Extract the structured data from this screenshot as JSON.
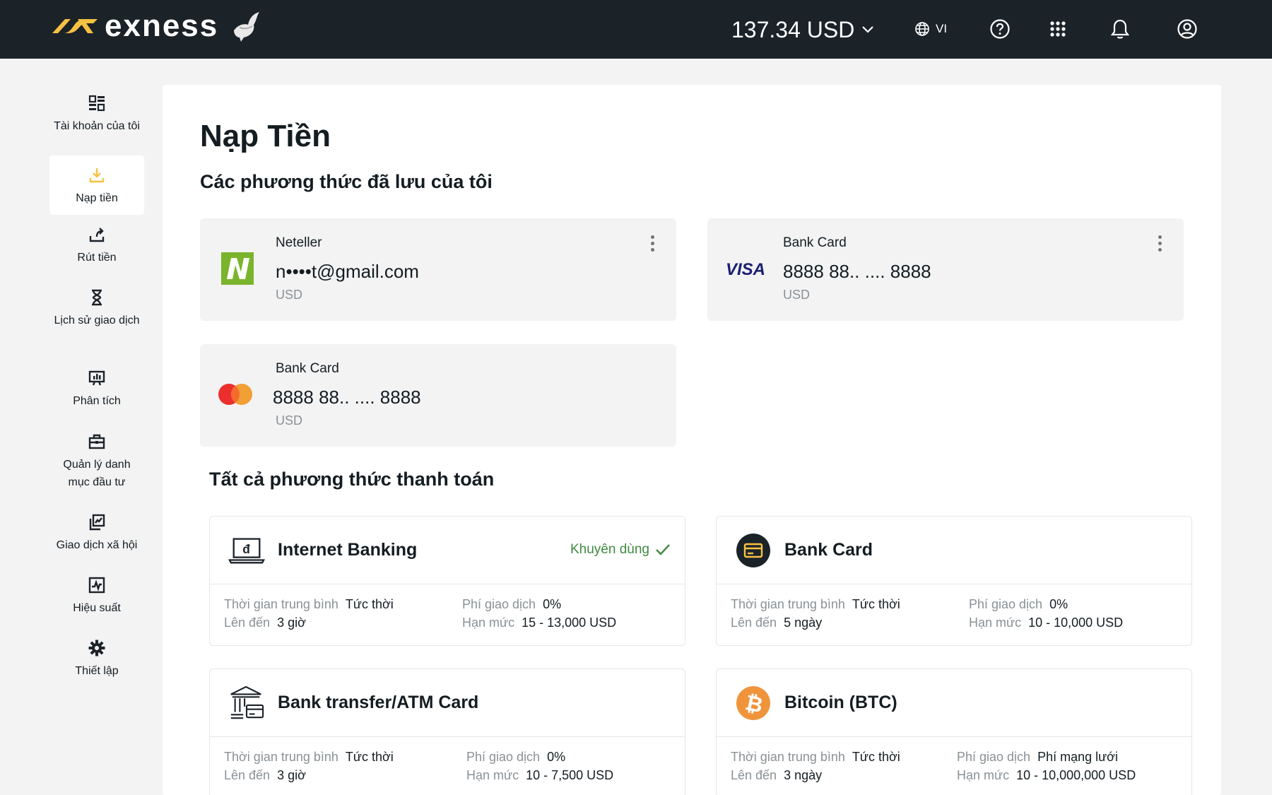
{
  "header": {
    "brand": "exness",
    "balance": "137.34 USD",
    "language": "VI",
    "icons": [
      "globe-icon",
      "help-icon",
      "apps-grid-icon",
      "bell-icon",
      "account-icon"
    ]
  },
  "sidebar": {
    "items": [
      {
        "label": "Tài khoản của tôi",
        "icon": "accounts-icon"
      },
      {
        "label": "Nạp tiền",
        "icon": "deposit-icon",
        "active": true
      },
      {
        "label": "Rút tiền",
        "icon": "withdraw-icon"
      },
      {
        "label": "Lịch sử giao dịch",
        "icon": "hourglass-icon"
      },
      {
        "label": "Phân tích",
        "icon": "analytics-icon"
      },
      {
        "label": "Quản lý danh mục đầu tư",
        "icon": "briefcase-icon"
      },
      {
        "label": "Giao dịch xã hội",
        "icon": "social-trading-icon"
      },
      {
        "label": "Hiệu suất",
        "icon": "performance-icon"
      },
      {
        "label": "Thiết lập",
        "icon": "gear-icon"
      }
    ]
  },
  "main": {
    "title": "Nạp Tiền",
    "saved_title": "Các phương thức đã lưu của tôi",
    "saved_methods": [
      {
        "name": "Neteller",
        "value": "n••••t@gmail.com",
        "currency": "USD",
        "logo": "neteller-icon"
      },
      {
        "name": "Bank Card",
        "value": "8888 88.. .... 8888",
        "currency": "USD",
        "logo": "visa-icon"
      },
      {
        "name": "Bank Card",
        "value": "8888 88.. .... 8888",
        "currency": "USD",
        "logo": "mastercard-icon"
      }
    ],
    "all_title": "Tất cả phương thức thanh toán",
    "labels": {
      "avg_time": "Thời gian trung bình",
      "up_to": "Lên đến",
      "fee": "Phí giao dịch",
      "limit": "Hạn mức"
    },
    "methods": [
      {
        "name": "Internet Banking",
        "recommended": "Khuyên dùng",
        "avg_time": "Tức thời",
        "up_to": "3 giờ",
        "fee": "0%",
        "limit": "15 - 13,000 USD",
        "icon": "laptop-dong-icon"
      },
      {
        "name": "Bank Card",
        "avg_time": "Tức thời",
        "up_to": "5 ngày",
        "fee": "0%",
        "limit": "10 - 10,000 USD",
        "icon": "bank-card-icon"
      },
      {
        "name": "Bank transfer/ATM Card",
        "avg_time": "Tức thời",
        "up_to": "3 giờ",
        "fee": "0%",
        "limit": "10 - 7,500 USD",
        "icon": "bank-building-icon"
      },
      {
        "name": "Bitcoin (BTC)",
        "avg_time": "Tức thời",
        "up_to": "3 ngày",
        "fee": "Phí mạng lưới",
        "limit": "10 - 10,000,000 USD",
        "icon": "bitcoin-icon"
      }
    ]
  },
  "colors": {
    "topbar": "#1b2329",
    "brand_yellow": "#f6c242",
    "recommended_green": "#3f8a41",
    "bitcoin_orange": "#f0943c",
    "neteller_green": "#7ab42c",
    "visa_blue": "#1a1f71"
  }
}
